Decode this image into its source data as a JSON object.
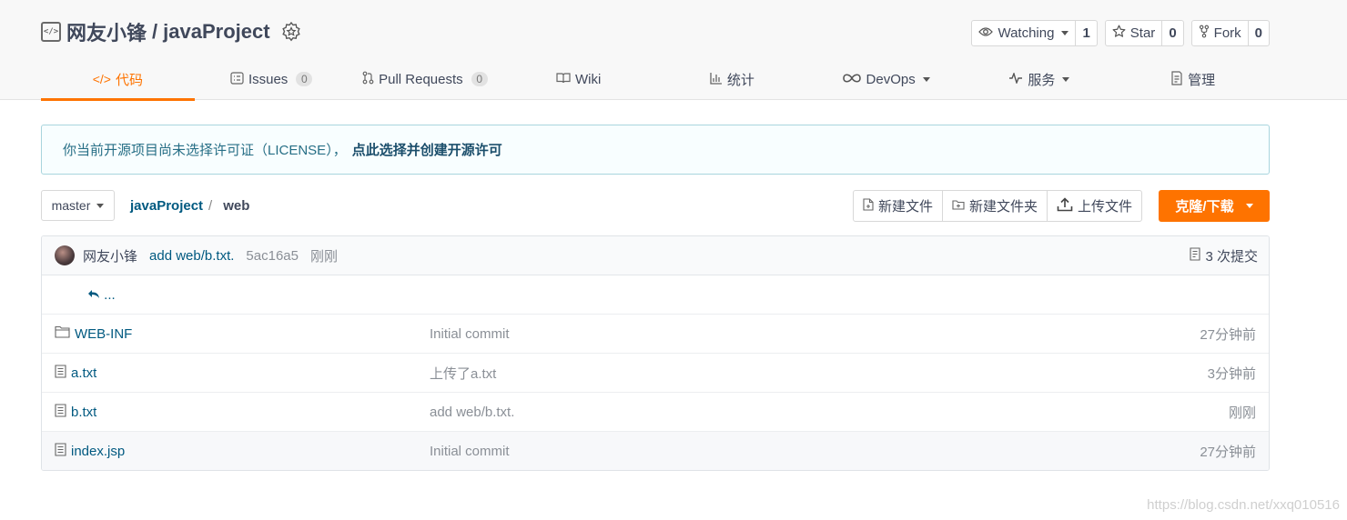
{
  "repo": {
    "owner": "网友小锋",
    "separator": "/",
    "name": "javaProject"
  },
  "actions": {
    "watch": {
      "label": "Watching",
      "count": "1"
    },
    "star": {
      "label": "Star",
      "count": "0"
    },
    "fork": {
      "label": "Fork",
      "count": "0"
    }
  },
  "tabs": [
    {
      "label": "代码",
      "icon": "code-icon",
      "active": true
    },
    {
      "label": "Issues",
      "badge": "0",
      "icon": "issues-icon"
    },
    {
      "label": "Pull Requests",
      "badge": "0",
      "icon": "pull-request-icon"
    },
    {
      "label": "Wiki",
      "icon": "wiki-icon"
    },
    {
      "label": "统计",
      "icon": "stats-icon"
    },
    {
      "label": "DevOps",
      "icon": "devops-icon",
      "dropdown": true
    },
    {
      "label": "服务",
      "icon": "service-icon",
      "dropdown": true
    },
    {
      "label": "管理",
      "icon": "manage-icon"
    }
  ],
  "notice": {
    "text": "你当前开源项目尚未选择许可证（LICENSE），",
    "link": "点此选择并创建开源许可"
  },
  "toolbar": {
    "branch": "master",
    "breadcrumb_root": "javaProject",
    "breadcrumb_sep": "/",
    "breadcrumb_current": "web",
    "new_file": "新建文件",
    "new_folder": "新建文件夹",
    "upload": "上传文件",
    "clone": "克隆/下载"
  },
  "commit": {
    "author": "网友小锋",
    "message": "add web/b.txt.",
    "sha": "5ac16a5",
    "time": "刚刚",
    "count": "3 次提交"
  },
  "parent_link": "...",
  "files": [
    {
      "name": "WEB-INF",
      "type": "folder",
      "message": "Initial commit",
      "time": "27分钟前"
    },
    {
      "name": "a.txt",
      "type": "file",
      "message": "上传了a.txt",
      "time": "3分钟前"
    },
    {
      "name": "b.txt",
      "type": "file",
      "message": "add web/b.txt.",
      "time": "刚刚"
    },
    {
      "name": "index.jsp",
      "type": "file",
      "message": "Initial commit",
      "time": "27分钟前"
    }
  ],
  "watermark": "https://blog.csdn.net/xxq010516",
  "colors": {
    "accent": "#fe7300",
    "link": "#005980"
  }
}
